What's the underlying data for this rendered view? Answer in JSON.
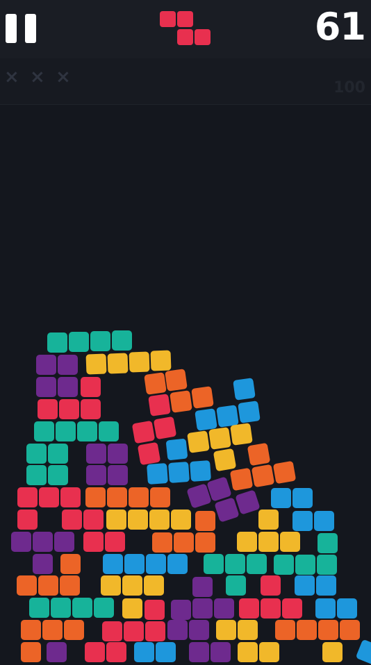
{
  "hud": {
    "score": "61",
    "target": "100",
    "strikes": [
      "×",
      "×",
      "×"
    ],
    "pause_icon": "pause-icon"
  },
  "colors": {
    "red": "#e8304f",
    "orange": "#ec6427",
    "yellow": "#f1b82a",
    "teal": "#17b39a",
    "blue": "#1e97dc",
    "purple": "#6e2a8e",
    "background": "#14171e",
    "topbar": "#1a1d24"
  },
  "next_piece": {
    "shape": "Z",
    "color": "red"
  }
}
